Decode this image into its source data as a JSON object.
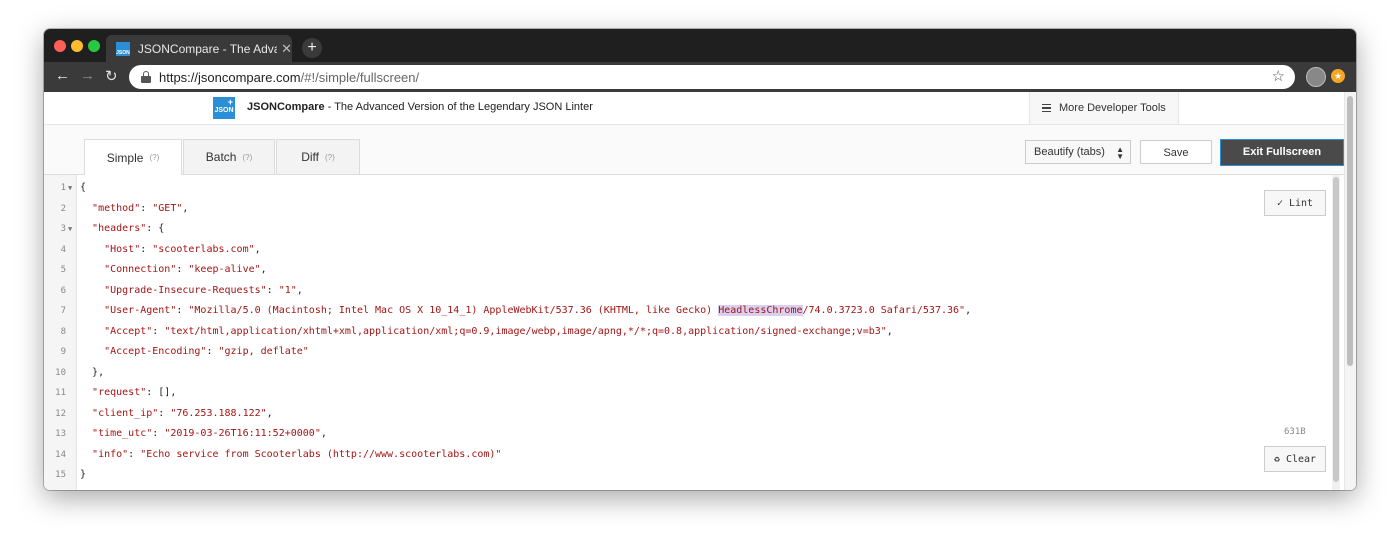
{
  "browser": {
    "tab_title": "JSONCompare - The Advanced",
    "tab_close": "✕",
    "new_tab": "+",
    "url_host": "https://jsoncompare.com",
    "url_path": "/#!/simple/fullscreen/",
    "favicon_text": "JSON"
  },
  "site": {
    "logo_text": "JSON",
    "logo_plus": "+",
    "brand": "JSONCompare",
    "tagline": " - The Advanced Version of the Legendary JSON Linter",
    "more_tools": "More Developer Tools"
  },
  "tabs": [
    {
      "label": "Simple",
      "hint": "(?)",
      "active": true
    },
    {
      "label": "Batch",
      "hint": "(?)",
      "active": false
    },
    {
      "label": "Diff",
      "hint": "(?)",
      "active": false
    }
  ],
  "controls": {
    "format_select": "Beautify (tabs)",
    "save_label": "Save",
    "exit_label": "Exit Fullscreen",
    "lint_label": "✓ Lint",
    "clear_label": "♻ Clear",
    "size": "631B"
  },
  "editor": {
    "line_numbers": [
      "1",
      "2",
      "3",
      "4",
      "5",
      "6",
      "7",
      "8",
      "9",
      "10",
      "11",
      "12",
      "13",
      "14",
      "15"
    ],
    "lines": [
      {
        "indent": "",
        "key": "",
        "sep": "",
        "value": "",
        "tail": "{"
      },
      {
        "indent": "  ",
        "key": "\"method\"",
        "sep": ": ",
        "value": "\"GET\"",
        "tail": ","
      },
      {
        "indent": "  ",
        "key": "\"headers\"",
        "sep": ": ",
        "value": "",
        "tail": "{"
      },
      {
        "indent": "    ",
        "key": "\"Host\"",
        "sep": ": ",
        "value": "\"scooterlabs.com\"",
        "tail": ","
      },
      {
        "indent": "    ",
        "key": "\"Connection\"",
        "sep": ": ",
        "value": "\"keep-alive\"",
        "tail": ","
      },
      {
        "indent": "    ",
        "key": "\"Upgrade-Insecure-Requests\"",
        "sep": ": ",
        "value": "\"1\"",
        "tail": ","
      },
      {
        "indent": "    ",
        "key": "\"User-Agent\"",
        "sep": ": ",
        "value": "\"Mozilla/5.0 (Macintosh; Intel Mac OS X 10_14_1) AppleWebKit/537.36 (KHTML, like Gecko) ",
        "highlight": "HeadlessChrome",
        "value_after": "/74.0.3723.0 Safari/537.36\"",
        "tail": ","
      },
      {
        "indent": "    ",
        "key": "\"Accept\"",
        "sep": ": ",
        "value": "\"text/html,application/xhtml+xml,application/xml;q=0.9,image/webp,image/apng,*/*;q=0.8,application/signed-exchange;v=b3\"",
        "tail": ","
      },
      {
        "indent": "    ",
        "key": "\"Accept-Encoding\"",
        "sep": ": ",
        "value": "\"gzip, deflate\"",
        "tail": ""
      },
      {
        "indent": "  ",
        "key": "",
        "sep": "",
        "value": "",
        "tail": "},"
      },
      {
        "indent": "  ",
        "key": "\"request\"",
        "sep": ": ",
        "value": "",
        "tail": "[],"
      },
      {
        "indent": "  ",
        "key": "\"client_ip\"",
        "sep": ": ",
        "value": "\"76.253.188.122\"",
        "tail": ","
      },
      {
        "indent": "  ",
        "key": "\"time_utc\"",
        "sep": ": ",
        "value": "\"2019-03-26T16:11:52+0000\"",
        "tail": ","
      },
      {
        "indent": "  ",
        "key": "\"info\"",
        "sep": ": ",
        "value": "\"Echo service from Scooterlabs (http://www.scooterlabs.com)\"",
        "tail": ""
      },
      {
        "indent": "",
        "key": "",
        "sep": "",
        "value": "",
        "tail": "}"
      }
    ]
  },
  "colors": {
    "json_string": "#a31515",
    "accent": "#2b8fd7",
    "highlight": "#d8d0ee"
  }
}
